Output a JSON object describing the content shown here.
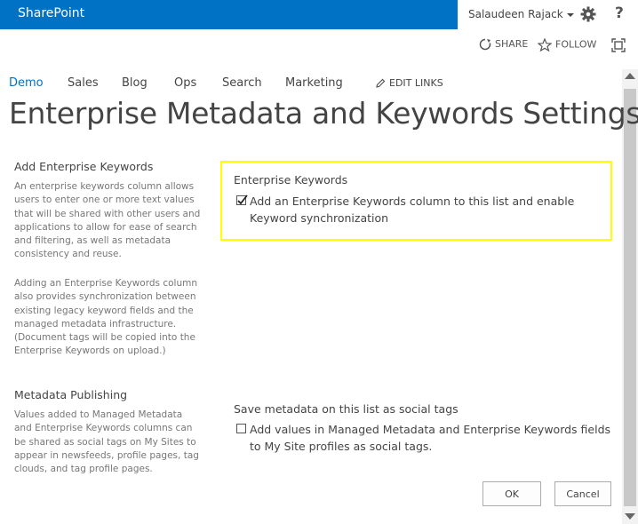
{
  "suite_bar": {
    "brand": "SharePoint",
    "user_name": "Salaudeen Rajack",
    "help_label": "?"
  },
  "action_bar": {
    "share_label": "SHARE",
    "follow_label": "FOLLOW"
  },
  "top_nav": {
    "items": [
      {
        "label": "Demo",
        "active": true
      },
      {
        "label": "Sales",
        "active": false
      },
      {
        "label": "Blog",
        "active": false
      },
      {
        "label": "Ops",
        "active": false
      },
      {
        "label": "Search",
        "active": false
      },
      {
        "label": "Marketing",
        "active": false
      }
    ],
    "edit_links_label": "EDIT LINKS"
  },
  "page": {
    "title": "Enterprise Metadata and Keywords Settings"
  },
  "sections": {
    "keywords": {
      "heading": "Add Enterprise Keywords",
      "description_1": "An enterprise keywords column allows users to enter one or more text values that will be shared with other users and applications to allow for ease of search and filtering, as well as metadata consistency and reuse.",
      "description_2": "Adding an Enterprise Keywords column also provides synchronization between existing legacy keyword fields and the managed metadata infrastructure. (Document tags will be copied into the Enterprise Keywords on upload.)",
      "group_label": "Enterprise Keywords",
      "checkbox_label": "Add an Enterprise Keywords column to this list and enable Keyword synchronization",
      "checked": true
    },
    "publishing": {
      "heading": "Metadata Publishing",
      "description": "Values added to Managed Metadata and Enterprise Keywords columns can be shared as social tags on My Sites to appear in newsfeeds, profile pages, tag clouds, and tag profile pages.",
      "group_label": "Save metadata on this list as social tags",
      "checkbox_label": "Add values in Managed Metadata and Enterprise Keywords fields to My Site profiles as social tags.",
      "checked": false
    }
  },
  "buttons": {
    "ok_label": "OK",
    "cancel_label": "Cancel"
  },
  "colors": {
    "brand_blue": "#0072c6",
    "highlight_yellow": "#ffff00"
  }
}
